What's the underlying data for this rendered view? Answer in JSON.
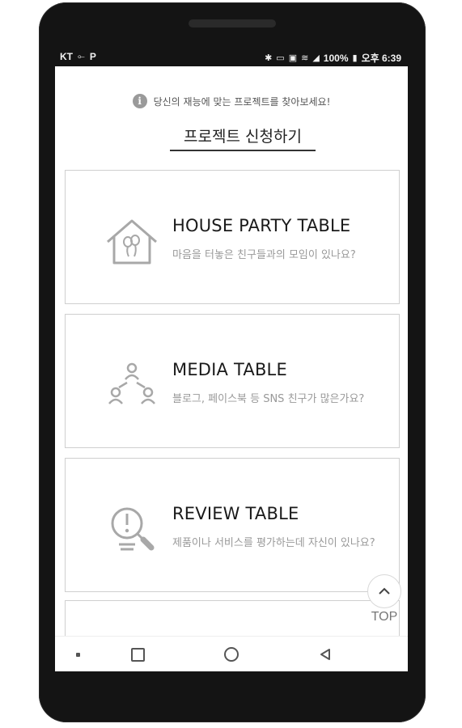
{
  "statusbar": {
    "carrier": "KT",
    "left_icons": [
      "usb-icon",
      "parking-icon"
    ],
    "right_icons": [
      "bluetooth-icon",
      "nfc-icon",
      "hd-icon",
      "wifi-icon",
      "signal-icon"
    ],
    "battery": "100%",
    "time": "오후 6:39"
  },
  "notice": {
    "icon": "info-icon",
    "text": "당신의 재능에 맞는 프로젝트를 찾아보세요!"
  },
  "page_title": "프로젝트 신청하기",
  "cards": [
    {
      "icon": "house-balloons-icon",
      "title": "HOUSE PARTY TABLE",
      "desc": "마음을 터놓은 친구들과의 모임이 있나요?"
    },
    {
      "icon": "network-people-icon",
      "title": "MEDIA TABLE",
      "desc": "블로그, 페이스북 등 SNS 친구가 많은가요?"
    },
    {
      "icon": "review-magnifier-icon",
      "title": "REVIEW TABLE",
      "desc": "제품이나 서비스를 평가하는데 자신이 있나요?"
    }
  ],
  "top_button": {
    "icon": "chevron-up-icon",
    "label": "TOP"
  },
  "navbar": {
    "items": [
      "menu-dot-icon",
      "recents-icon",
      "home-icon",
      "back-icon"
    ]
  },
  "colors": {
    "frame": "#141414",
    "screen": "#ffffff",
    "card_border": "#cfcfcf",
    "desc_text": "#999999",
    "icon_stroke": "#a8a8a8"
  }
}
